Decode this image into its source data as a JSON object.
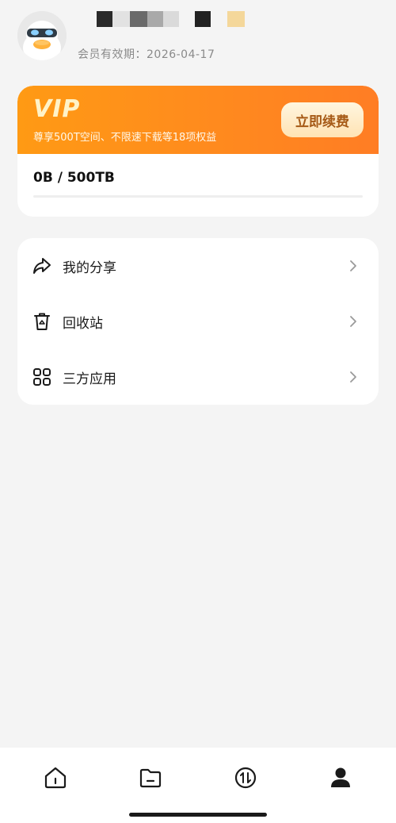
{
  "profile": {
    "avatar_icon": "duck-avatar",
    "username_redacted": true,
    "expiry_label": "会员有效期：2026-04-17"
  },
  "vip": {
    "title": "VIP",
    "description": "尊享500T空间、不限速下载等18项权益",
    "renew_button": "立即续费",
    "storage_text": "0B / 500TB",
    "storage_used_fraction": 0,
    "accent_color": "#ff8a1e"
  },
  "menu": {
    "items": [
      {
        "label": "我的分享",
        "icon": "share-icon"
      },
      {
        "label": "回收站",
        "icon": "trash-icon"
      },
      {
        "label": "三方应用",
        "icon": "apps-grid-icon"
      }
    ]
  },
  "bottom_nav": {
    "items": [
      {
        "icon": "home-icon",
        "active": false
      },
      {
        "icon": "folder-icon",
        "active": false
      },
      {
        "icon": "transfer-icon",
        "active": false
      },
      {
        "icon": "profile-icon",
        "active": true
      }
    ]
  }
}
